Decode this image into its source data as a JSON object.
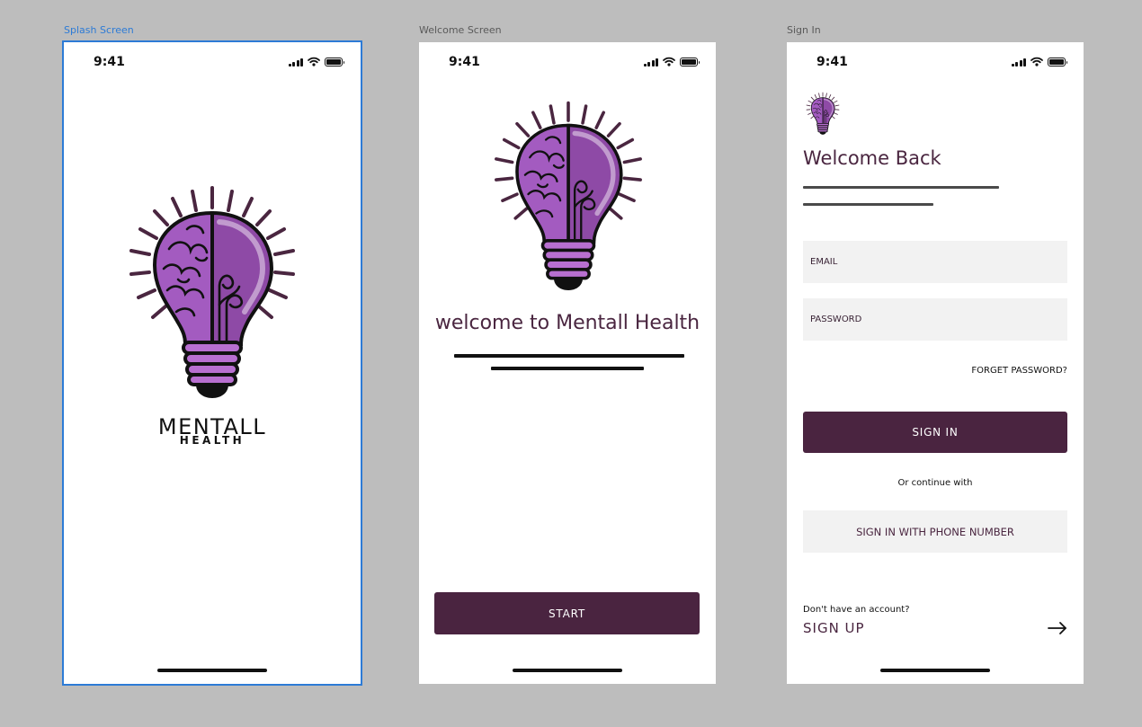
{
  "frames": [
    {
      "id": "splash",
      "label": "Splash Screen"
    },
    {
      "id": "welcome",
      "label": "Welcome Screen"
    },
    {
      "id": "signin",
      "label": "Sign In"
    }
  ],
  "status_bar": {
    "time": "9:41"
  },
  "splash": {
    "brand_main": "MENTALL",
    "brand_sub": "HEALTH"
  },
  "welcome": {
    "title": "welcome to Mentall Health",
    "start_label": "START"
  },
  "signin": {
    "title": "Welcome Back",
    "email_placeholder": "EMAIL",
    "password_placeholder": "PASSWORD",
    "forget_label": "FORGET PASSWORD?",
    "signin_label": "SIGN IN",
    "or_text": "Or continue with",
    "phone_label": "SIGN IN WITH PHONE NUMBER",
    "no_account": "Don't have an account?",
    "signup_label": "SIGN UP"
  },
  "colors": {
    "primary": "#4a2440",
    "field_bg": "#f2f2f2",
    "canvas_bg": "#bdbdbd",
    "selection": "#2d7bd6",
    "bulb_purple": "#8e4aa6",
    "brain_purple": "#a35bc0"
  },
  "icons": {
    "logo": "lightbulb-brain-icon",
    "signal": "cell-signal-icon",
    "wifi": "wifi-icon",
    "battery": "battery-icon",
    "arrow": "arrow-right-icon"
  }
}
